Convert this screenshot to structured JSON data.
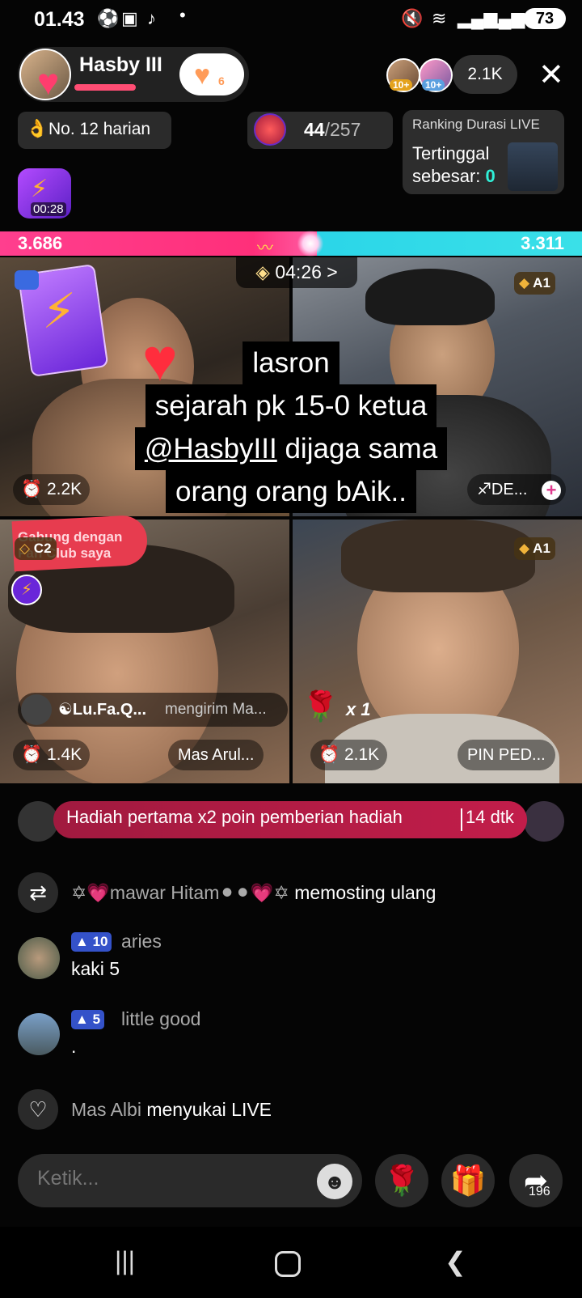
{
  "status": {
    "time": "01.43",
    "battery": "73"
  },
  "host": {
    "name": "Hasby III",
    "follow_count": "6"
  },
  "viewers": {
    "badge1": "10+",
    "badge2": "10+",
    "count": "2.1K"
  },
  "rank": {
    "label": "No. 12 harian"
  },
  "goal": {
    "current": "44",
    "total": "/257"
  },
  "duration": {
    "title": "Ranking Durasi LIVE",
    "line1": "Tertinggal",
    "line2_prefix": "sebesar: ",
    "line2_value": "0"
  },
  "boost": {
    "time": "00:28"
  },
  "pk": {
    "left_score": "3.686",
    "right_score": "3.311",
    "timer": "04:26 >"
  },
  "tiles": [
    {
      "score": "2.2K"
    },
    {
      "rank": "A1",
      "name": "♐DE..."
    },
    {
      "rank": "C2",
      "score": "1.4K",
      "name": "Mas Arul...",
      "banner": "Gabung dengan Fan Club saya"
    },
    {
      "rank": "A1",
      "score": "2.1K",
      "name": "PIN PED..."
    }
  ],
  "caption": {
    "line1": "lasron",
    "line2": "sejarah pk 15-0 ketua",
    "line3_mention": "@HasbyIII",
    "line3_rest": " dijaga sama",
    "line4": "orang orang bAik.."
  },
  "gift_message": {
    "name": "☯Lu.Fa.Q...",
    "text": "mengirim Ma...",
    "multiplier": "x 1"
  },
  "promo": {
    "text": "Hadiah pertama x2 poin pemberian hadiah",
    "seconds": "14 dtk"
  },
  "comments": {
    "repost": {
      "user": "✡💗mawar Hitam⚫⚫💗✡",
      "action": " memosting ulang"
    },
    "c2": {
      "level": "10",
      "user": "aries",
      "text": "kaki 5"
    },
    "c3": {
      "level": "5",
      "user": "little good",
      "text": "."
    },
    "like": {
      "user": "Mas Albi",
      "action": " menyukai LIVE"
    }
  },
  "input": {
    "placeholder": "Ketik..."
  },
  "share": {
    "count": "196"
  },
  "icons": {
    "close": "close-icon",
    "repost": "repost-icon",
    "heart": "heart-icon",
    "gift": "gift-icon",
    "rose": "rose-icon",
    "share": "share-icon",
    "emoji": "emoji-icon"
  },
  "colors": {
    "pk_left": "#ff2f7a",
    "pk_right": "#19c9e8",
    "promo": "#c21d4a",
    "level_badge": "#3452c9"
  }
}
